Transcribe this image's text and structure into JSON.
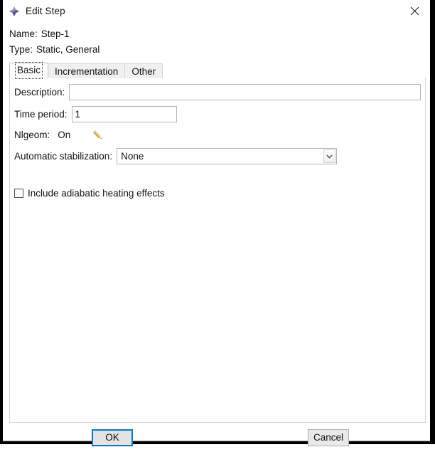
{
  "window": {
    "title": "Edit Step",
    "icon": "abaqus-diamond-icon",
    "close_icon": "close-icon"
  },
  "header": {
    "name_label": "Name:",
    "name_value": "Step-1",
    "type_label": "Type:",
    "type_value": "Static, General"
  },
  "tabs": [
    {
      "label": "Basic",
      "active": true
    },
    {
      "label": "Incrementation",
      "active": false
    },
    {
      "label": "Other",
      "active": false
    }
  ],
  "basic": {
    "description_label": "Description:",
    "description_value": "",
    "description_placeholder": "",
    "time_period_label": "Time period:",
    "time_period_value": "1",
    "nlgeom_label": "Nlgeom:",
    "nlgeom_value": "On",
    "nlgeom_edit_icon": "pencil-icon",
    "stabilization_label": "Automatic stabilization:",
    "stabilization_value": "None",
    "stabilization_options": [
      "None"
    ],
    "stabilization_arrow_icon": "chevron-down-icon",
    "adiabatic_label": "Include adiabatic heating effects",
    "adiabatic_checked": false
  },
  "footer": {
    "ok_label": "OK",
    "cancel_label": "Cancel"
  },
  "colors": {
    "accent": "#0078d7",
    "icon_purple": "#6f6fae",
    "pencil_orange": "#e8a33d",
    "panel_border": "#d6d6d6",
    "tab_inactive_bg": "#f0f0f0"
  }
}
